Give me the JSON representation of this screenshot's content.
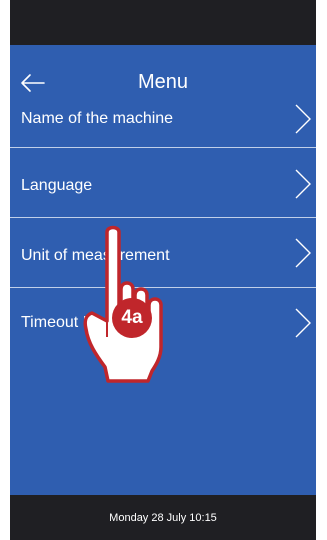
{
  "header": {
    "title": "Menu",
    "back_icon": "arrow-left-icon"
  },
  "menu": {
    "items": [
      {
        "label": "Name of the machine",
        "icon": "chevron-right-icon"
      },
      {
        "label": "Language",
        "icon": "chevron-right-icon"
      },
      {
        "label": "Unit of measurement",
        "icon": "chevron-right-icon"
      },
      {
        "label": "Timeout Idle",
        "icon": "chevron-right-icon"
      }
    ]
  },
  "overlay": {
    "step_badge": "4a",
    "gesture_icon": "tap-hand-icon",
    "badge_color": "#c0262b"
  },
  "status_bar": {
    "datetime": "Monday 28 July 10:15"
  },
  "colors": {
    "screen_background": "#2f5eb0",
    "device_frame": "#1f1f23",
    "text": "#ffffff"
  }
}
